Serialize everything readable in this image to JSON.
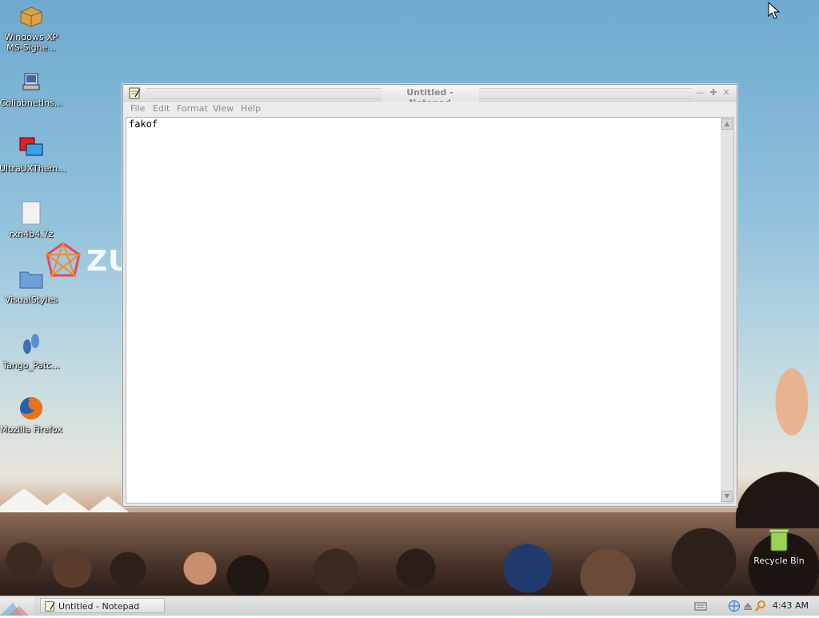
{
  "desktop": {
    "icons": [
      {
        "label": "Windows XP MS-Signe...",
        "icon": "package-icon"
      },
      {
        "label": "CollabnetIns...",
        "icon": "installer-icon"
      },
      {
        "label": "UltraUXThem...",
        "icon": "theme-patcher-icon"
      },
      {
        "label": "rxn4b4.7z",
        "icon": "file-icon"
      },
      {
        "label": "VisualStyles",
        "icon": "folder-icon"
      },
      {
        "label": "Tango_Patc...",
        "icon": "footprint-icon"
      },
      {
        "label": "Mozilla Firefox",
        "icon": "firefox-icon"
      }
    ],
    "recycle_bin": {
      "label": "Recycle Bin",
      "icon": "recycle-bin-icon"
    },
    "wallpaper_logo_text": "ZU"
  },
  "notepad": {
    "title": "Untitled - Notepad",
    "menu": [
      "File",
      "Edit",
      "Format",
      "View",
      "Help"
    ],
    "content": "fakof",
    "controls": {
      "minimize": "—",
      "maximize": "✚",
      "close": "✕"
    }
  },
  "taskbar": {
    "task_label": "Untitled - Notepad",
    "clock": "4:43 AM"
  },
  "colors": {
    "title_text": "#8a8a8a",
    "taskbar": "#d9d9d9"
  }
}
